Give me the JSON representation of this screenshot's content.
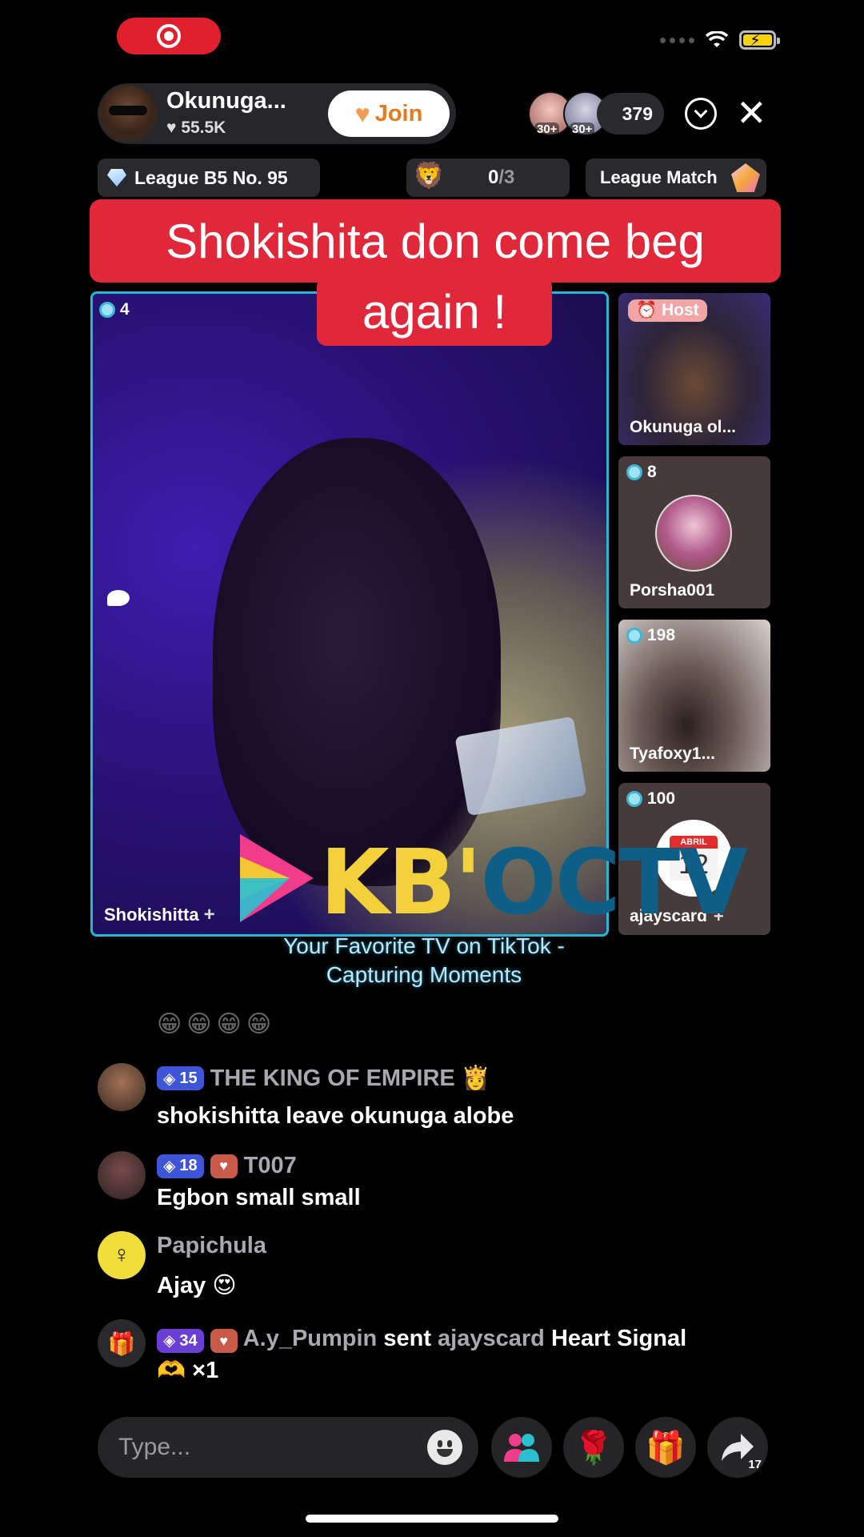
{
  "status_bar": {
    "record_icon": "record-icon",
    "wifi_icon": "wifi-icon",
    "battery_icon": "battery-charging-icon"
  },
  "host": {
    "name": "Okunuga...",
    "likes": "55.5K",
    "join_label": "Join"
  },
  "viewers": {
    "avatars": [
      {
        "badge": "30+"
      },
      {
        "badge": "30+"
      }
    ],
    "count": "379"
  },
  "info_row": {
    "league": "League B5 No. 95",
    "progress_done": "0",
    "progress_total": "/3",
    "match": "League Match"
  },
  "caption": {
    "line1": "Shokishita don come beg",
    "line2": "again !"
  },
  "main_guest": {
    "score": "4",
    "name": "Shokishitta"
  },
  "guests": [
    {
      "tag": "Host",
      "name": "Okunuga ol..."
    },
    {
      "score": "8",
      "name": "Porsha001"
    },
    {
      "score": "198",
      "name": "Tyafoxy1..."
    },
    {
      "score": "100",
      "name": "ajayscard",
      "calendar_month": "ABRIL",
      "calendar_day": "12"
    }
  ],
  "watermark": {
    "logo_part1": "KB'",
    "logo_part2": "OCTV",
    "tagline_line1": "Your Favorite TV on TikTok  -",
    "tagline_line2": "Capturing Moments"
  },
  "chat": {
    "faded_emojis": "😁😁😁😁",
    "messages": [
      {
        "level": "15",
        "username": "THE KING OF EMPIRE 👸",
        "text": "shokishitta leave okunuga alobe"
      },
      {
        "level": "18",
        "username": "T007",
        "text": "Egbon small small"
      },
      {
        "username": "Papichula",
        "text": "Ajay 😍"
      }
    ],
    "gift": {
      "level": "34",
      "sender": "A.y_Pumpin",
      "verb": "sent",
      "recipient": "ajayscard",
      "gift_name": "Heart Signal",
      "count": "×1"
    }
  },
  "bottom_bar": {
    "input_placeholder": "Type...",
    "share_count": "17"
  },
  "colors": {
    "accent_red": "#e1273a",
    "frame_cyan": "#24b8d6",
    "join_orange": "#e67a1e"
  }
}
